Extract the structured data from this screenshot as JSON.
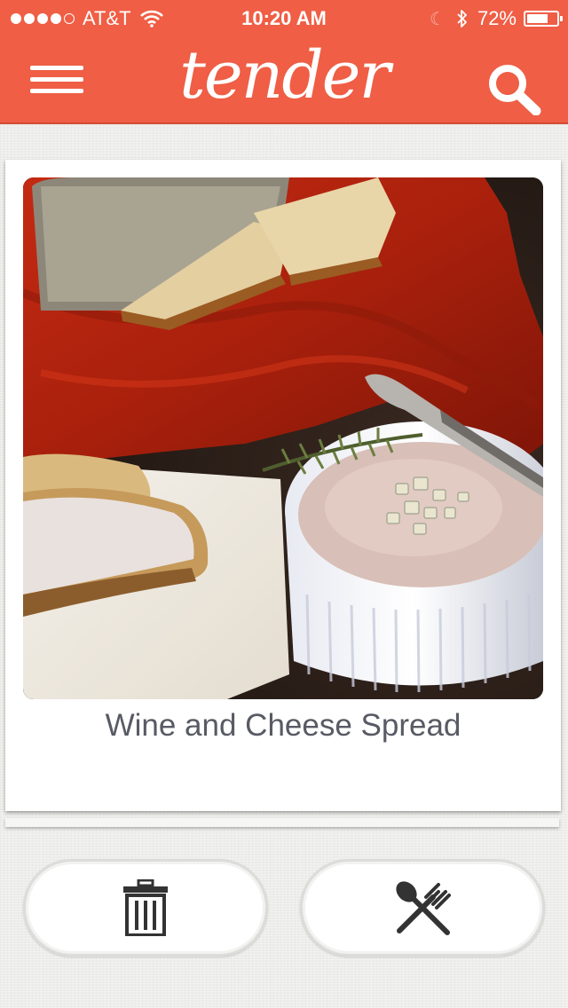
{
  "status_bar": {
    "carrier": "AT&T",
    "time": "10:20 AM",
    "battery_percent_text": "72%",
    "battery_level": 0.72,
    "signal_bars_filled": 4,
    "signal_bars_total": 5,
    "icons": [
      "signal-dots",
      "wifi-icon",
      "moon-icon",
      "bluetooth-icon",
      "battery-icon"
    ]
  },
  "header": {
    "logo_text": "tender",
    "background_color": "#ef5e45",
    "left_icon": "hamburger-menu-icon",
    "right_icon": "search-icon"
  },
  "card": {
    "title": "Wine and Cheese Spread",
    "image_description_icon": "recipe-photo"
  },
  "actions": {
    "left_icon": "trash-icon",
    "right_icon": "spoon-fork-icon"
  }
}
